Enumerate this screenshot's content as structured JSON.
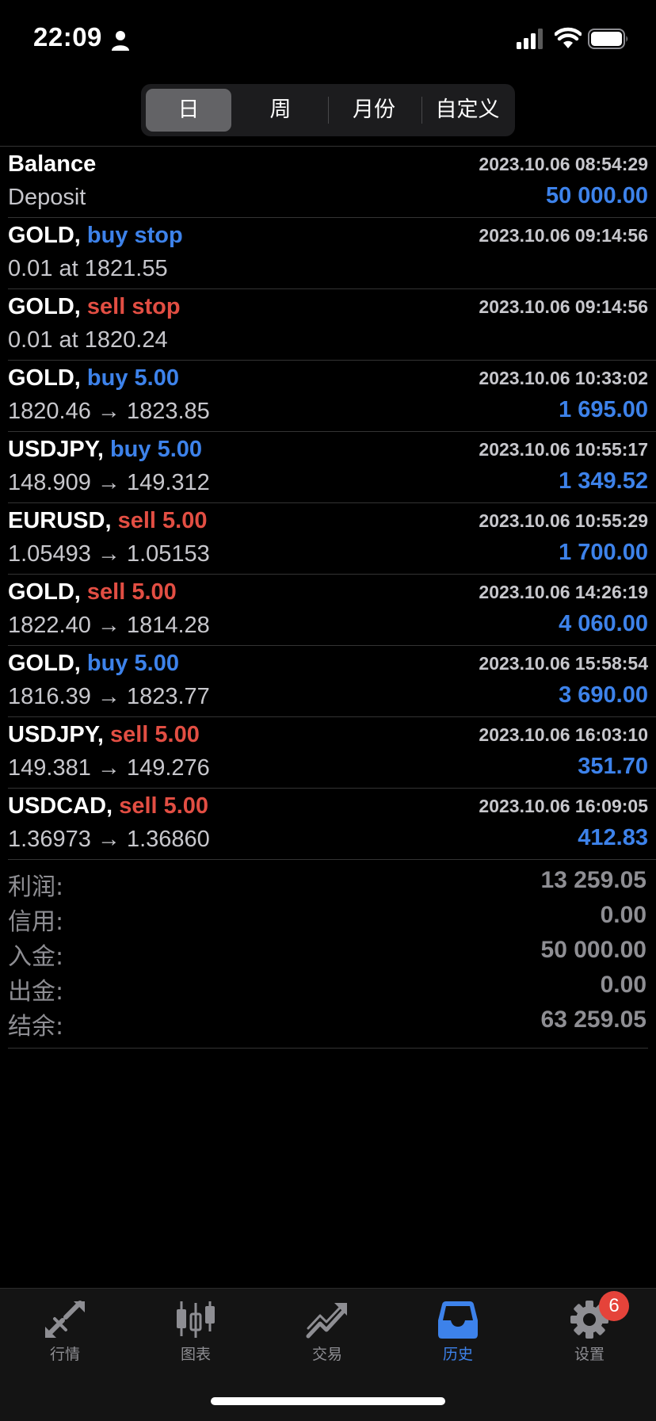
{
  "status_bar": {
    "time": "22:09"
  },
  "segments": [
    {
      "label": "日",
      "active": true
    },
    {
      "label": "周",
      "active": false
    },
    {
      "label": "月份",
      "active": false
    },
    {
      "label": "自定义",
      "active": false
    }
  ],
  "history": [
    {
      "symbol": "Balance",
      "action": "",
      "action_color": "",
      "time": "2023.10.06 08:54:29",
      "subtitle": "Deposit",
      "profit": "50 000.00"
    },
    {
      "symbol": "GOLD,",
      "action": "buy stop",
      "action_color": "buy",
      "time": "2023.10.06 09:14:56",
      "subtitle": "0.01 at 1821.55",
      "profit": ""
    },
    {
      "symbol": "GOLD,",
      "action": "sell stop",
      "action_color": "sell",
      "time": "2023.10.06 09:14:56",
      "subtitle": "0.01 at 1820.24",
      "profit": ""
    },
    {
      "symbol": "GOLD,",
      "action": "buy 5.00",
      "action_color": "buy",
      "time": "2023.10.06 10:33:02",
      "subtitle": "1820.46 → 1823.85",
      "profit": "1 695.00"
    },
    {
      "symbol": "USDJPY,",
      "action": "buy 5.00",
      "action_color": "buy",
      "time": "2023.10.06 10:55:17",
      "subtitle": "148.909 → 149.312",
      "profit": "1 349.52"
    },
    {
      "symbol": "EURUSD,",
      "action": "sell 5.00",
      "action_color": "sell",
      "time": "2023.10.06 10:55:29",
      "subtitle": "1.05493 → 1.05153",
      "profit": "1 700.00"
    },
    {
      "symbol": "GOLD,",
      "action": "sell 5.00",
      "action_color": "sell",
      "time": "2023.10.06 14:26:19",
      "subtitle": "1822.40 → 1814.28",
      "profit": "4 060.00"
    },
    {
      "symbol": "GOLD,",
      "action": "buy 5.00",
      "action_color": "buy",
      "time": "2023.10.06 15:58:54",
      "subtitle": "1816.39 → 1823.77",
      "profit": "3 690.00"
    },
    {
      "symbol": "USDJPY,",
      "action": "sell 5.00",
      "action_color": "sell",
      "time": "2023.10.06 16:03:10",
      "subtitle": "149.381 → 149.276",
      "profit": "351.70"
    },
    {
      "symbol": "USDCAD,",
      "action": "sell 5.00",
      "action_color": "sell",
      "time": "2023.10.06 16:09:05",
      "subtitle": "1.36973 → 1.36860",
      "profit": "412.83"
    }
  ],
  "summary": [
    {
      "label": "利润:",
      "value": "13 259.05"
    },
    {
      "label": "信用:",
      "value": "0.00"
    },
    {
      "label": "入金:",
      "value": "50 000.00"
    },
    {
      "label": "出金:",
      "value": "0.00"
    },
    {
      "label": "结余:",
      "value": "63 259.05"
    }
  ],
  "tabs": [
    {
      "label": "行情",
      "icon": "quotes-icon",
      "active": false
    },
    {
      "label": "图表",
      "icon": "chart-icon",
      "active": false
    },
    {
      "label": "交易",
      "icon": "trade-icon",
      "active": false
    },
    {
      "label": "历史",
      "icon": "history-icon",
      "active": true
    },
    {
      "label": "设置",
      "icon": "settings-icon",
      "active": false
    }
  ],
  "settings_badge": "6",
  "colors": {
    "buy": "#3d82ea",
    "sell": "#e24e43",
    "accent": "#3d82ea",
    "badge": "#e5433a"
  }
}
